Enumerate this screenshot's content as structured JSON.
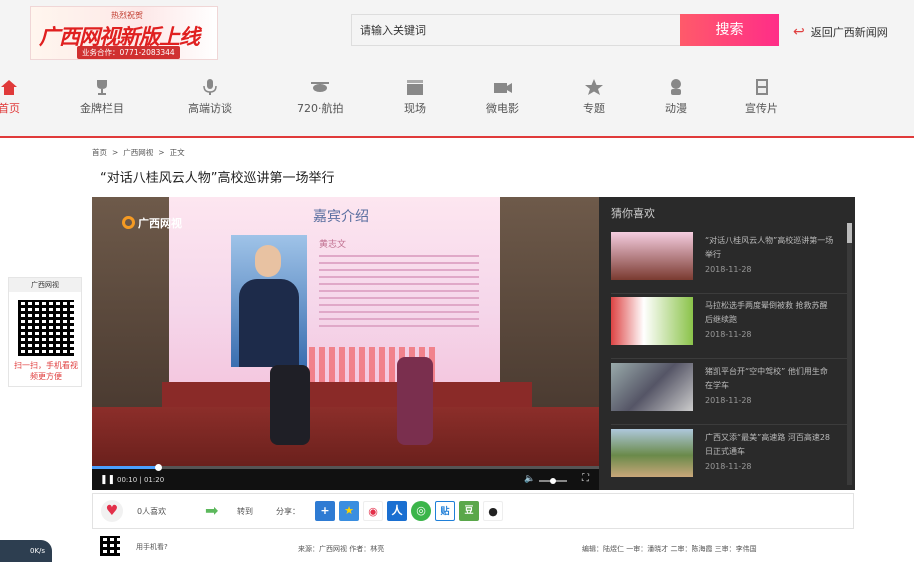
{
  "header": {
    "banner": {
      "small": "热烈祝贺",
      "big": "广西网视新版上线",
      "phone": "业务合作：0771-2083344"
    },
    "search_placeholder": "请输入关键词",
    "search_button": "搜索",
    "back_link": "返回广西新闻网"
  },
  "nav": [
    {
      "label": "首页",
      "icon": "home-icon",
      "active": true
    },
    {
      "label": "金牌栏目",
      "icon": "trophy-icon"
    },
    {
      "label": "高端访谈",
      "icon": "microphone-icon"
    },
    {
      "label": "720·航拍",
      "icon": "drone-icon"
    },
    {
      "label": "现场",
      "icon": "clapper-icon"
    },
    {
      "label": "微电影",
      "icon": "camera-icon"
    },
    {
      "label": "专题",
      "icon": "star-icon"
    },
    {
      "label": "动漫",
      "icon": "mascot-icon"
    },
    {
      "label": "宣传片",
      "icon": "film-icon"
    }
  ],
  "breadcrumb": [
    "首页",
    "广西网视",
    "正文"
  ],
  "article_title": "“对话八桂风云人物”高校巡讲第一场举行",
  "player": {
    "logo": "广西网视",
    "slide_heading": "嘉宾介绍",
    "slide_name": "黄志文",
    "time": "00:10 | 01:20",
    "progress": 0.13,
    "volume": 0.5
  },
  "sidebar": {
    "heading": "猜你喜欢",
    "items": [
      {
        "title": "“对话八桂风云人物”高校巡讲第一场举行",
        "date": "2018-11-28"
      },
      {
        "title": "马拉松选手两度晕倒被救 抢救苏醒后继续跑",
        "date": "2018-11-28"
      },
      {
        "title": "猪凯平台开“空中驾校” 他们用生命在学车",
        "date": "2018-11-28"
      },
      {
        "title": "广西又添“最美”高速路 河百高速28日正式通车",
        "date": "2018-11-28"
      }
    ]
  },
  "actions": {
    "likes": "0人喜欢",
    "forward": "转到",
    "share": "分享："
  },
  "qr_float": {
    "header": "广西网视",
    "caption": "扫一扫，手机看视频更方便"
  },
  "footer": {
    "mobile": "用手机看?",
    "source": "来源：广西网视   作者：林亮",
    "editors": "编辑：陆煜仁    一审：潘晓才    二审：陈海霞    三审：李伟国"
  },
  "gauge": "0K/s",
  "colors": {
    "accent": "#e03a3a",
    "search_button": "#ff3d7f",
    "sidebar_bg": "#2a2a2a"
  }
}
